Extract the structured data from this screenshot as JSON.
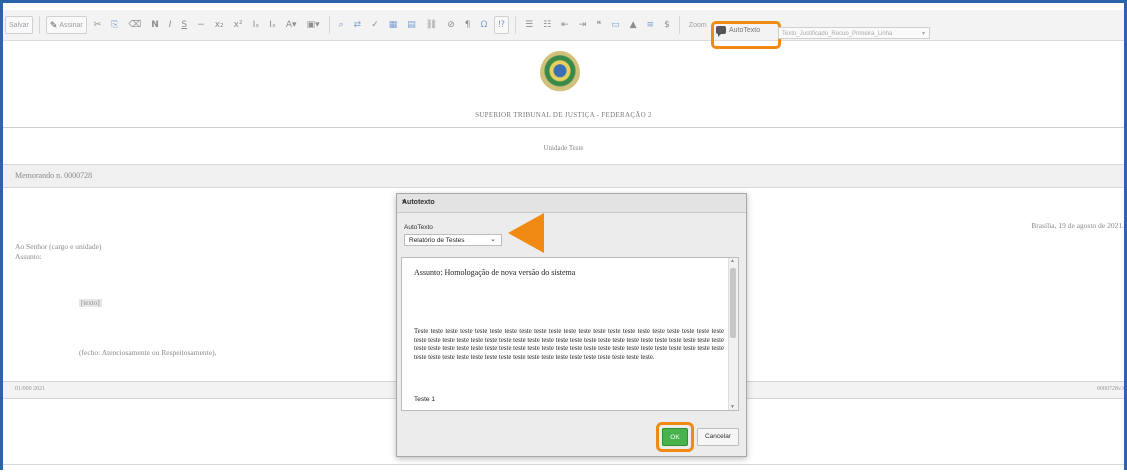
{
  "toolbar": {
    "save": "Salvar",
    "sign": "Assinar",
    "bold": "N",
    "italic": "I",
    "underline": "S",
    "zoom": "Zoom",
    "autotexto": "AutoTexto",
    "template_select": "Texto_Justificado_Recuo_Primeira_Linha"
  },
  "document": {
    "court": "SUPERIOR TRIBUNAL DE JUSTIÇA - FEDERAÇÃO 2",
    "unit": "Unidade Teste",
    "memo": "Memorando n. 0000728",
    "date": "Brasília, 19 de agosto de 2021.",
    "addressee": "Ao Senhor (cargo e unidade)",
    "subject_label": "Assunto:",
    "texto_placeholder": "[texto]",
    "fecho": "(fecho: Atenciosamente ou Respeitosamente),",
    "footer_left": "01/000 2021",
    "footer_right": "0000728v3"
  },
  "dialog": {
    "title": "Autotexto",
    "close": "×",
    "field_label": "AutoTexto",
    "selected": "Relatório de Testes",
    "subject": "Assunto: Homologação de nova versão do sistema",
    "body": "Teste teste teste teste teste teste teste teste teste teste teste teste teste teste teste teste teste teste teste teste teste teste teste teste teste teste teste teste teste teste teste teste teste teste teste teste teste teste teste teste teste teste teste teste teste teste teste teste teste teste teste teste teste teste teste teste teste teste teste teste teste teste teste teste teste teste teste teste teste teste teste teste teste teste teste teste teste teste teste teste teste teste.",
    "next_heading": "Teste 1",
    "ok": "OK",
    "cancel": "Cancelar"
  },
  "colors": {
    "highlight": "#f08a12",
    "frame": "#2b64a8",
    "ok_green": "#49b24c",
    "close_red": "#d93a2a"
  }
}
